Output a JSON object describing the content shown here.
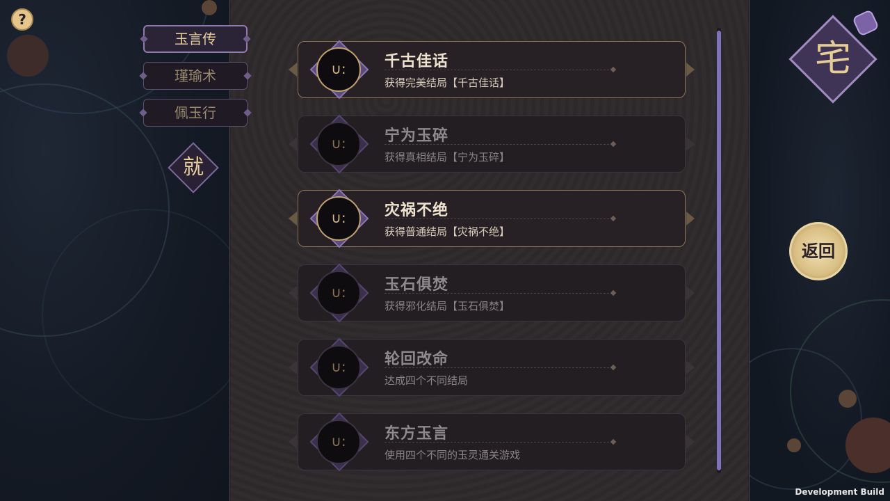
{
  "help": {
    "icon": "?"
  },
  "tabs": [
    {
      "label": "玉言传",
      "active": true
    },
    {
      "label": "瑾瑜术",
      "active": false
    },
    {
      "label": "佩玉行",
      "active": false
    }
  ],
  "side_badge": {
    "label": "就"
  },
  "achievements": [
    {
      "title": "千古佳话",
      "description": "获得完美结局【千古佳话】",
      "unlocked": true,
      "icon": "∪:"
    },
    {
      "title": "宁为玉碎",
      "description": "获得真相结局【宁为玉碎】",
      "unlocked": false,
      "icon": "∪:"
    },
    {
      "title": "灾祸不绝",
      "description": "获得普通结局【灾祸不绝】",
      "unlocked": true,
      "icon": "∪:"
    },
    {
      "title": "玉石俱焚",
      "description": "获得邪化结局【玉石俱焚】",
      "unlocked": false,
      "icon": "∪:"
    },
    {
      "title": "轮回改命",
      "description": "达成四个不同结局",
      "unlocked": false,
      "icon": "∪:"
    },
    {
      "title": "东方玉言",
      "description": "使用四个不同的玉灵通关游戏",
      "unlocked": false,
      "icon": "∪:"
    }
  ],
  "home_badge": {
    "label": "宅"
  },
  "return_button": {
    "label": "返回"
  },
  "footer": {
    "build_label": "Development Build"
  }
}
